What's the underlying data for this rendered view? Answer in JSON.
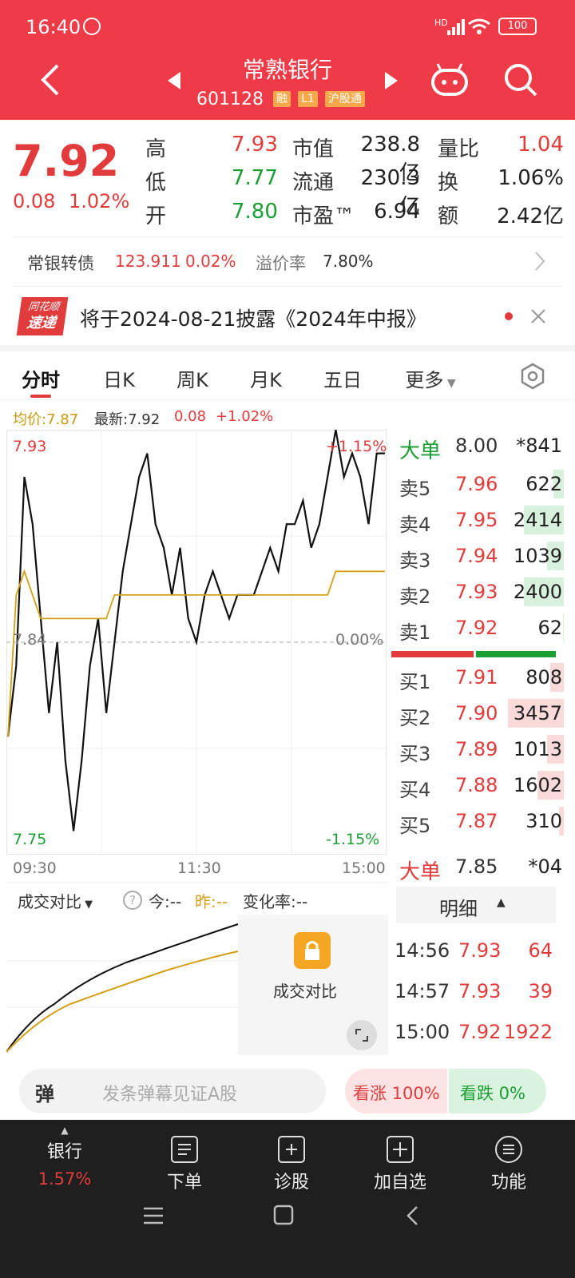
{
  "status_bar": {
    "time": "16:40",
    "signal_label": "HD",
    "battery": "100"
  },
  "header": {
    "title": "常熟银行",
    "code": "601128",
    "badges": [
      "融",
      "L1",
      "沪股通"
    ]
  },
  "quote": {
    "price": "7.92",
    "change": "0.08",
    "change_pct": "1.02%",
    "stats": [
      {
        "label": "高",
        "value": "7.93",
        "color": "#e23b3b"
      },
      {
        "label": "低",
        "value": "7.77",
        "color": "#1b9e33"
      },
      {
        "label": "开",
        "value": "7.80",
        "color": "#1b9e33"
      },
      {
        "label": "市值",
        "value": "238.8亿"
      },
      {
        "label": "流通",
        "value": "230.3亿"
      },
      {
        "label": "市盈™",
        "value": "6.94"
      },
      {
        "label": "量比",
        "value": "1.04",
        "color": "#e23b3b"
      },
      {
        "label": "换",
        "value": "1.06%"
      },
      {
        "label": "额",
        "value": "2.42亿"
      }
    ]
  },
  "bond": {
    "name": "常银转债",
    "price": "123.911",
    "pct": "0.02%",
    "premium_label": "溢价率",
    "premium": "7.80%"
  },
  "news": {
    "logo_top": "同花顺",
    "logo_bottom": "速递",
    "text": "将于2024-08-21披露《2024年中报》"
  },
  "tabs": [
    "分时",
    "日K",
    "周K",
    "月K",
    "五日",
    "更多"
  ],
  "chart_info": {
    "avg_label": "均价:7.87",
    "latest_label": "最新:7.92",
    "change": "0.08",
    "change_pct": "+1.02%"
  },
  "chart_data": {
    "type": "line",
    "y_top_label": "7.93",
    "y_bottom_label": "7.75",
    "y_mid_label": "7.84",
    "pct_top": "+1.15%",
    "pct_mid": "0.00%",
    "pct_bottom": "-1.15%",
    "x_labels": [
      "09:30",
      "11:30",
      "15:00"
    ],
    "ylim": [
      7.75,
      7.93
    ],
    "series": [
      {
        "values": [
          7.8,
          7.83,
          7.91,
          7.89,
          7.85,
          7.81,
          7.84,
          7.79,
          7.76,
          7.79,
          7.83,
          7.85,
          7.81,
          7.84,
          7.87,
          7.89,
          7.91,
          7.92,
          7.89,
          7.88,
          7.86,
          7.88,
          7.85,
          7.84,
          7.86,
          7.87,
          7.86,
          7.85,
          7.86,
          7.86,
          7.86,
          7.87,
          7.88,
          7.87,
          7.89,
          7.89,
          7.9,
          7.88,
          7.89,
          7.91,
          7.93,
          7.91,
          7.92,
          7.91,
          7.89,
          7.92,
          7.92
        ]
      },
      {
        "values": [
          7.8,
          7.86,
          7.87,
          7.86,
          7.85,
          7.85,
          7.85,
          7.85,
          7.85,
          7.85,
          7.85,
          7.85,
          7.85,
          7.86,
          7.86,
          7.86,
          7.86,
          7.86,
          7.86,
          7.86,
          7.86,
          7.86,
          7.86,
          7.86,
          7.86,
          7.86,
          7.86,
          7.86,
          7.86,
          7.86,
          7.86,
          7.86,
          7.86,
          7.86,
          7.86,
          7.86,
          7.86,
          7.86,
          7.86,
          7.86,
          7.87,
          7.87,
          7.87,
          7.87,
          7.87,
          7.87,
          7.87
        ]
      }
    ],
    "colors": {
      "price_line": "#111111",
      "avg_line": "#d4a017"
    }
  },
  "order_book": {
    "big_sell": {
      "label": "大单",
      "price": "8.00",
      "vol": "*841"
    },
    "asks": [
      {
        "label": "卖5",
        "price": "7.96",
        "vol": "622",
        "share": 0.18
      },
      {
        "label": "卖4",
        "price": "7.95",
        "vol": "2414",
        "share": 0.72
      },
      {
        "label": "卖3",
        "price": "7.94",
        "vol": "1039",
        "share": 0.3
      },
      {
        "label": "卖2",
        "price": "7.93",
        "vol": "2400",
        "share": 0.71
      },
      {
        "label": "卖1",
        "price": "7.92",
        "vol": "62",
        "share": 0.02
      }
    ],
    "bids": [
      {
        "label": "买1",
        "price": "7.91",
        "vol": "808",
        "share": 0.24
      },
      {
        "label": "买2",
        "price": "7.90",
        "vol": "3457",
        "share": 1.0
      },
      {
        "label": "买3",
        "price": "7.89",
        "vol": "1013",
        "share": 0.3
      },
      {
        "label": "买4",
        "price": "7.88",
        "vol": "1602",
        "share": 0.47
      },
      {
        "label": "买5",
        "price": "7.87",
        "vol": "310",
        "share": 0.09
      }
    ],
    "big_buy": {
      "label": "大单",
      "price": "7.85",
      "vol": "*04"
    }
  },
  "compare": {
    "title": "成交对比",
    "today": "今:--",
    "yesterday": "昨:--",
    "rate": "变化率:--",
    "lock_label": "成交对比"
  },
  "detail": {
    "title": "明细",
    "rows": [
      {
        "time": "14:56",
        "price": "7.93",
        "vol": "64"
      },
      {
        "time": "14:57",
        "price": "7.93",
        "vol": "39"
      },
      {
        "time": "15:00",
        "price": "7.92",
        "vol": "1922"
      }
    ]
  },
  "comment": {
    "placeholder": "发条弹幕见证A股",
    "bullet": "弹",
    "up_label": "看涨 100%",
    "down_label": "看跌 0%"
  },
  "bottom_nav": {
    "sector": "银行",
    "sector_pct": "1.57%",
    "items": [
      "下单",
      "诊股",
      "加自选",
      "功能"
    ]
  }
}
